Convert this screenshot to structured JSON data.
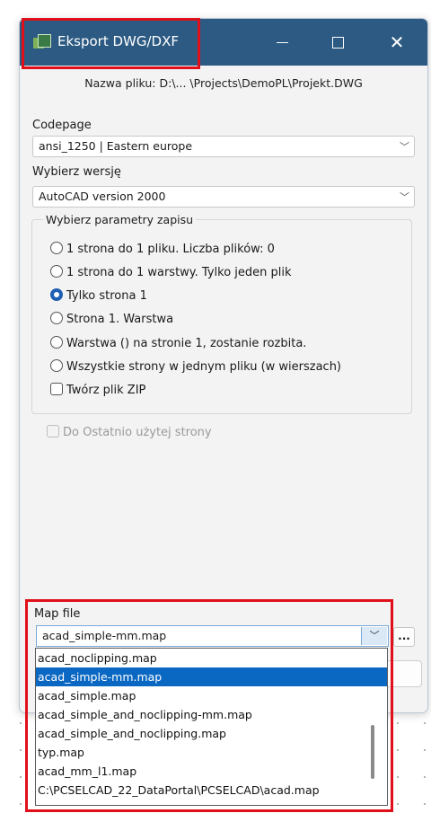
{
  "window": {
    "title": "Eksport DWG/DXF",
    "filename_line": "Nazwa pliku: D:\\... \\Projects\\DemoPL\\Projekt.DWG"
  },
  "codepage": {
    "label": "Codepage",
    "value": "ansi_1250 | Eastern europe"
  },
  "version": {
    "label": "Wybierz wersję",
    "value": "AutoCAD version 2000"
  },
  "save_params": {
    "title": "Wybierz parametry zapisu",
    "options": [
      {
        "label": "1 strona do 1 pliku. Liczba plików: 0",
        "selected": false
      },
      {
        "label": "1 strona do 1 warstwy. Tylko jeden plik",
        "selected": false
      },
      {
        "label": "Tylko strona 1",
        "selected": true
      },
      {
        "label": "Strona 1. Warstwa",
        "selected": false
      },
      {
        "label": "Warstwa () na stronie 1, zostanie rozbita.",
        "selected": false
      },
      {
        "label": "Wszystkie strony w jednym pliku (w wierszach)",
        "selected": false
      }
    ],
    "zip_checkbox": {
      "label": "Twórz plik ZIP",
      "checked": false
    }
  },
  "last_page_checkbox": {
    "label": "Do Ostatnio użytej strony",
    "checked": false,
    "enabled": false
  },
  "map_file": {
    "label": "Map file",
    "value": "acad_simple-mm.map",
    "browse_label": "...",
    "options": [
      "acad_noclipping.map",
      "acad_simple-mm.map",
      "acad_simple.map",
      "acad_simple_and_noclipping-mm.map",
      "acad_simple_and_noclipping.map",
      "typ.map",
      "acad_mm_l1.map",
      "C:\\PCSELCAD_22_DataPortal\\PCSELCAD\\acad.map"
    ],
    "selected_index": 1
  },
  "colors": {
    "titlebar": "#2c5a82",
    "selection": "#0a67c2",
    "highlight_box": "#e0101b"
  }
}
